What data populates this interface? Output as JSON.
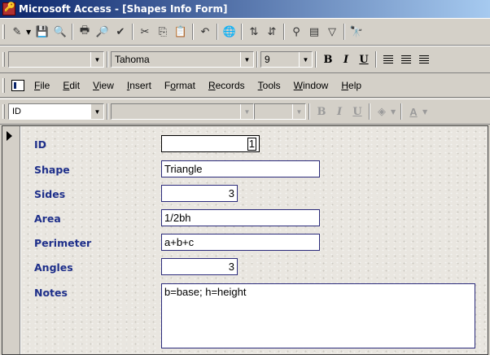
{
  "window": {
    "title": "Microsoft Access - [Shapes Info Form]"
  },
  "toolbar_font": {
    "font_name": "Tahoma",
    "font_size": "9",
    "bold_label": "B",
    "italic_label": "I",
    "underline_label": "U"
  },
  "menu": {
    "items": [
      {
        "label": "File",
        "key": "F"
      },
      {
        "label": "Edit",
        "key": "E"
      },
      {
        "label": "View",
        "key": "V"
      },
      {
        "label": "Insert",
        "key": "I"
      },
      {
        "label": "Format",
        "key": "o"
      },
      {
        "label": "Records",
        "key": "R"
      },
      {
        "label": "Tools",
        "key": "T"
      },
      {
        "label": "Window",
        "key": "W"
      },
      {
        "label": "Help",
        "key": "H"
      }
    ]
  },
  "formatting": {
    "object_combo": "ID",
    "bold_label": "B",
    "italic_label": "I",
    "underline_label": "U",
    "fill_label": "A"
  },
  "form": {
    "fields": {
      "id": {
        "label": "ID",
        "value": "1"
      },
      "shape": {
        "label": "Shape",
        "value": "Triangle"
      },
      "sides": {
        "label": "Sides",
        "value": "3"
      },
      "area": {
        "label": "Area",
        "value": "1/2bh"
      },
      "perimeter": {
        "label": "Perimeter",
        "value": "a+b+c"
      },
      "angles": {
        "label": "Angles",
        "value": "3"
      },
      "notes": {
        "label": "Notes",
        "value": "b=base; h=height"
      }
    }
  },
  "colors": {
    "label_text": "#1e2f8a",
    "title_bar": "#0a246a",
    "field_border": "#2a2a7a"
  }
}
